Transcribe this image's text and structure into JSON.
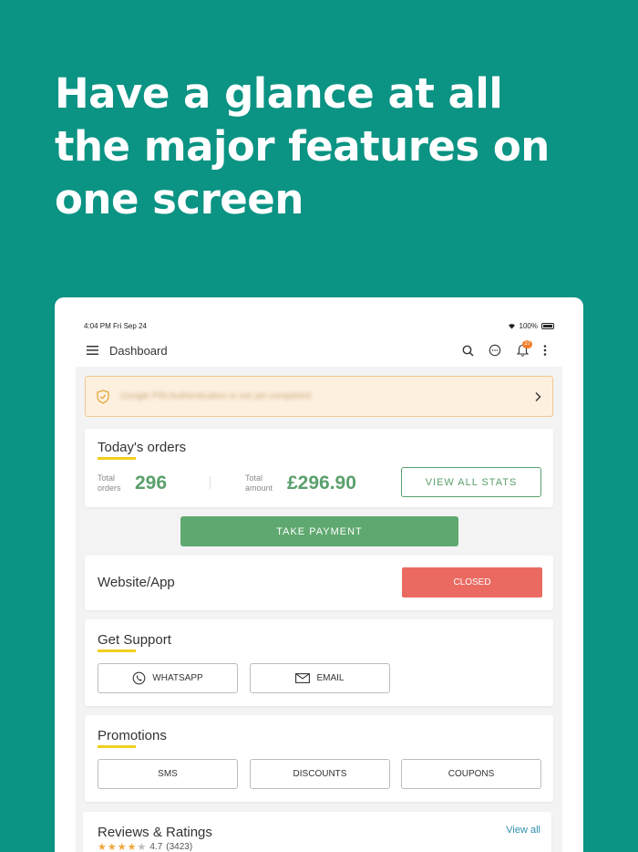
{
  "headline": {
    "line1": "Have a glance at all",
    "line2": "the major features on",
    "line3": "one screen"
  },
  "statusbar": {
    "time": "4:04 PM  Fri Sep 24",
    "battery": "100%"
  },
  "appbar": {
    "title": "Dashboard",
    "notification_count": "27"
  },
  "alert": {
    "text": "Google PIN Authentication is not yet completed"
  },
  "todays_orders": {
    "title": "Today's orders",
    "orders_label_1": "Total",
    "orders_label_2": "orders",
    "orders_value": "296",
    "amount_label_1": "Total",
    "amount_label_2": "amount",
    "amount_value": "£296.90",
    "view_stats_label": "VIEW ALL STATS"
  },
  "take_payment_label": "TAKE PAYMENT",
  "website": {
    "title": "Website/App",
    "status": "CLOSED"
  },
  "support": {
    "title": "Get Support",
    "whatsapp": "WHATSAPP",
    "email": "EMAIL"
  },
  "promotions": {
    "title": "Promotions",
    "sms": "SMS",
    "discounts": "DISCOUNTS",
    "coupons": "COUPONS"
  },
  "reviews": {
    "title": "Reviews & Ratings",
    "view_all": "View all",
    "rating": "4.7",
    "count": "(3423)",
    "stars_filled": 4
  },
  "colors": {
    "background": "#0b9383",
    "accent_green": "#5aa06c",
    "closed_red": "#ea6a62",
    "underline_yellow": "#f2cf1f",
    "link_blue": "#2f8fb0"
  }
}
